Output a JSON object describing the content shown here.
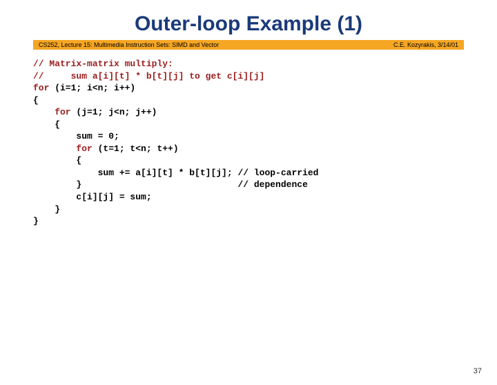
{
  "title": "Outer-loop Example (1)",
  "header": {
    "left": "CS252, Lecture 15: Multimedia Instruction Sets: SIMD and Vector",
    "right": "C.E. Kozyrakis, 3/14/01"
  },
  "code": {
    "c1": "// Matrix-matrix multiply:",
    "c2": "//     sum a[i][t] * b[t][j] to get c[i][j]",
    "l1a": "for",
    "l1b": " (i=1; i<n; i++)",
    "l2": "{",
    "l3a": "    for",
    "l3b": " (j=1; j<n; j++)",
    "l4": "    {",
    "l5": "        sum = 0;",
    "l6a": "        for",
    "l6b": " (t=1; t<n; t++)",
    "l7": "        {",
    "l8": "            sum += a[i][t] * b[t][j]; // loop-carried",
    "l9": "        }                             // dependence",
    "l10": "        c[i][j] = sum;",
    "l11": "    }",
    "l12": "}"
  },
  "page_number": "37"
}
